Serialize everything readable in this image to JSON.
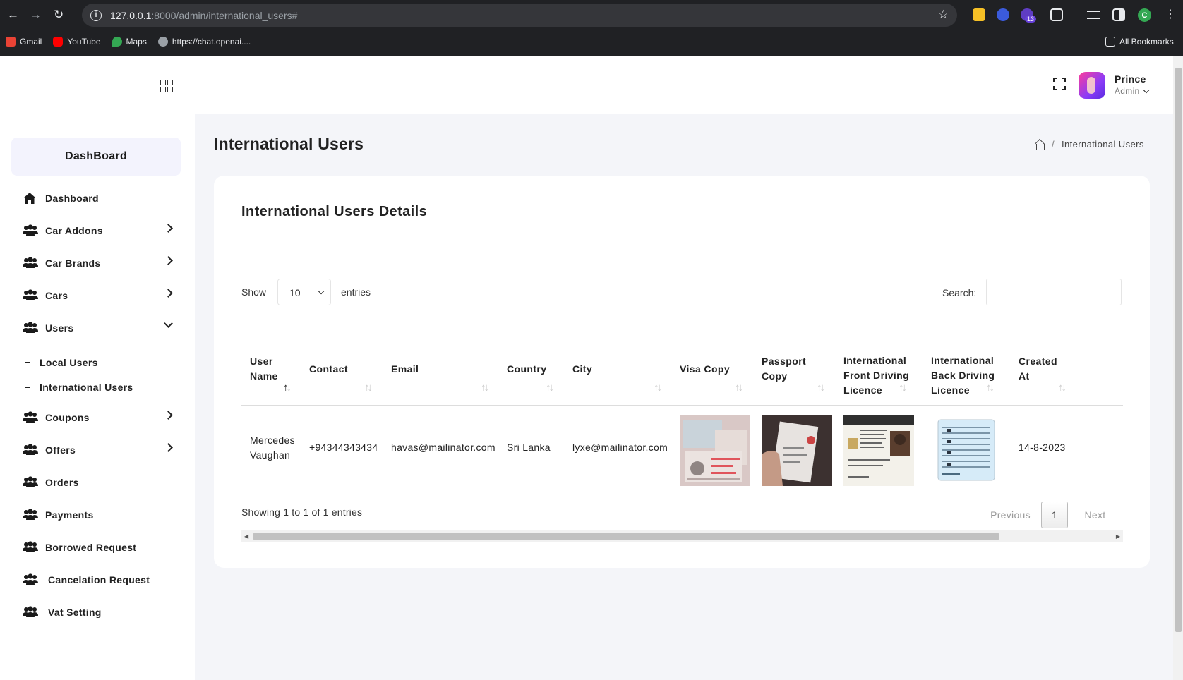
{
  "browser": {
    "url_host": "127.0.0.1",
    "url_path": ":8000/admin/international_users#",
    "extension_badge": "13",
    "profile_initial": "C",
    "bookmarks": [
      {
        "label": "Gmail",
        "color": "#ea4335"
      },
      {
        "label": "YouTube",
        "color": "#ff0000"
      },
      {
        "label": "Maps",
        "color": "#34a853"
      },
      {
        "label": "https://chat.openai....",
        "color": "#9aa0a6"
      }
    ],
    "all_bookmarks": "All Bookmarks"
  },
  "sidebar": {
    "brand": "DashBoard",
    "items": [
      {
        "label": "Dashboard",
        "icon": "home-icon",
        "chevron": ""
      },
      {
        "label": "Car Addons",
        "icon": "users-icon",
        "chevron": "right"
      },
      {
        "label": "Car Brands",
        "icon": "users-icon",
        "chevron": "right"
      },
      {
        "label": "Cars",
        "icon": "users-icon",
        "chevron": "right"
      },
      {
        "label": "Users",
        "icon": "users-icon",
        "chevron": "down"
      }
    ],
    "subitems": [
      {
        "label": "Local Users"
      },
      {
        "label": "International Users"
      }
    ],
    "items2": [
      {
        "label": "Coupons",
        "chevron": "right"
      },
      {
        "label": "Offers",
        "chevron": "right"
      },
      {
        "label": "Orders",
        "chevron": ""
      },
      {
        "label": "Payments",
        "chevron": ""
      },
      {
        "label": "Borrowed Request",
        "chevron": ""
      },
      {
        "label": "Cancelation Request",
        "chevron": ""
      },
      {
        "label": "Vat Setting",
        "chevron": ""
      }
    ]
  },
  "topbar": {
    "user_name": "Prince",
    "user_role": "Admin"
  },
  "page": {
    "title": "International Users",
    "breadcrumb_sep": "/",
    "breadcrumb_current": "International Users"
  },
  "card": {
    "title": "International Users Details",
    "show_label": "Show",
    "entries_value": "10",
    "entries_label": "entries",
    "search_label": "Search:",
    "search_value": "",
    "columns": [
      {
        "label": "User Name",
        "sorted": "asc"
      },
      {
        "label": "Contact",
        "sorted": ""
      },
      {
        "label": "Email",
        "sorted": ""
      },
      {
        "label": "Country",
        "sorted": ""
      },
      {
        "label": "City",
        "sorted": ""
      },
      {
        "label": "Visa Copy",
        "sorted": ""
      },
      {
        "label": "Passport Copy",
        "sorted": ""
      },
      {
        "label": "International Front Driving Licence",
        "sorted": ""
      },
      {
        "label": "International Back Driving Licence",
        "sorted": ""
      },
      {
        "label": "Created At",
        "sorted": ""
      }
    ],
    "rows": [
      {
        "user_name": "Mercedes Vaughan",
        "contact": "+94344343434",
        "email": "havas@mailinator.com",
        "country": "Sri Lanka",
        "city": "lyxe@mailinator.com",
        "visa_copy": "visa-image",
        "passport_copy": "passport-image",
        "front_licence": "front-licence-image",
        "back_licence": "back-licence-image",
        "created_at": "14-8-2023"
      }
    ],
    "showing_text": "Showing 1 to 1 of 1 entries",
    "pagination": {
      "previous": "Previous",
      "current": "1",
      "next": "Next"
    }
  }
}
